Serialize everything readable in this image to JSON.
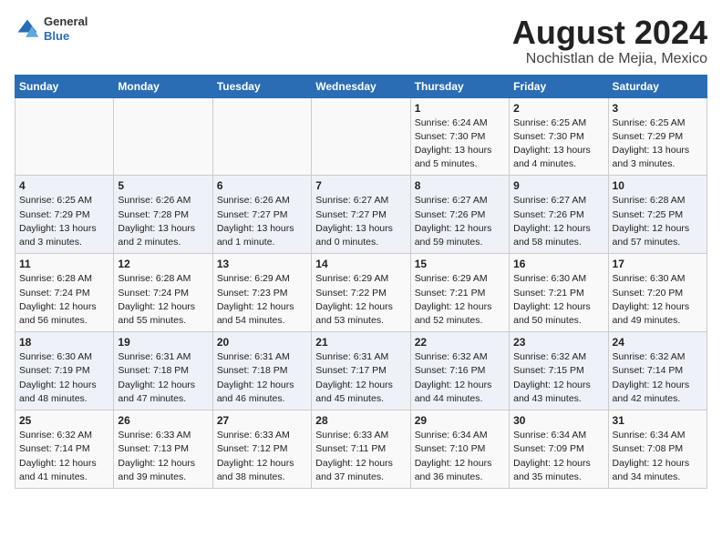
{
  "header": {
    "logo_general": "General",
    "logo_blue": "Blue",
    "title": "August 2024",
    "subtitle": "Nochistlan de Mejia, Mexico"
  },
  "days_of_week": [
    "Sunday",
    "Monday",
    "Tuesday",
    "Wednesday",
    "Thursday",
    "Friday",
    "Saturday"
  ],
  "weeks": [
    [
      {
        "day": "",
        "text": ""
      },
      {
        "day": "",
        "text": ""
      },
      {
        "day": "",
        "text": ""
      },
      {
        "day": "",
        "text": ""
      },
      {
        "day": "1",
        "text": "Sunrise: 6:24 AM\nSunset: 7:30 PM\nDaylight: 13 hours\nand 5 minutes."
      },
      {
        "day": "2",
        "text": "Sunrise: 6:25 AM\nSunset: 7:30 PM\nDaylight: 13 hours\nand 4 minutes."
      },
      {
        "day": "3",
        "text": "Sunrise: 6:25 AM\nSunset: 7:29 PM\nDaylight: 13 hours\nand 3 minutes."
      }
    ],
    [
      {
        "day": "4",
        "text": "Sunrise: 6:25 AM\nSunset: 7:29 PM\nDaylight: 13 hours\nand 3 minutes."
      },
      {
        "day": "5",
        "text": "Sunrise: 6:26 AM\nSunset: 7:28 PM\nDaylight: 13 hours\nand 2 minutes."
      },
      {
        "day": "6",
        "text": "Sunrise: 6:26 AM\nSunset: 7:27 PM\nDaylight: 13 hours\nand 1 minute."
      },
      {
        "day": "7",
        "text": "Sunrise: 6:27 AM\nSunset: 7:27 PM\nDaylight: 13 hours\nand 0 minutes."
      },
      {
        "day": "8",
        "text": "Sunrise: 6:27 AM\nSunset: 7:26 PM\nDaylight: 12 hours\nand 59 minutes."
      },
      {
        "day": "9",
        "text": "Sunrise: 6:27 AM\nSunset: 7:26 PM\nDaylight: 12 hours\nand 58 minutes."
      },
      {
        "day": "10",
        "text": "Sunrise: 6:28 AM\nSunset: 7:25 PM\nDaylight: 12 hours\nand 57 minutes."
      }
    ],
    [
      {
        "day": "11",
        "text": "Sunrise: 6:28 AM\nSunset: 7:24 PM\nDaylight: 12 hours\nand 56 minutes."
      },
      {
        "day": "12",
        "text": "Sunrise: 6:28 AM\nSunset: 7:24 PM\nDaylight: 12 hours\nand 55 minutes."
      },
      {
        "day": "13",
        "text": "Sunrise: 6:29 AM\nSunset: 7:23 PM\nDaylight: 12 hours\nand 54 minutes."
      },
      {
        "day": "14",
        "text": "Sunrise: 6:29 AM\nSunset: 7:22 PM\nDaylight: 12 hours\nand 53 minutes."
      },
      {
        "day": "15",
        "text": "Sunrise: 6:29 AM\nSunset: 7:21 PM\nDaylight: 12 hours\nand 52 minutes."
      },
      {
        "day": "16",
        "text": "Sunrise: 6:30 AM\nSunset: 7:21 PM\nDaylight: 12 hours\nand 50 minutes."
      },
      {
        "day": "17",
        "text": "Sunrise: 6:30 AM\nSunset: 7:20 PM\nDaylight: 12 hours\nand 49 minutes."
      }
    ],
    [
      {
        "day": "18",
        "text": "Sunrise: 6:30 AM\nSunset: 7:19 PM\nDaylight: 12 hours\nand 48 minutes."
      },
      {
        "day": "19",
        "text": "Sunrise: 6:31 AM\nSunset: 7:18 PM\nDaylight: 12 hours\nand 47 minutes."
      },
      {
        "day": "20",
        "text": "Sunrise: 6:31 AM\nSunset: 7:18 PM\nDaylight: 12 hours\nand 46 minutes."
      },
      {
        "day": "21",
        "text": "Sunrise: 6:31 AM\nSunset: 7:17 PM\nDaylight: 12 hours\nand 45 minutes."
      },
      {
        "day": "22",
        "text": "Sunrise: 6:32 AM\nSunset: 7:16 PM\nDaylight: 12 hours\nand 44 minutes."
      },
      {
        "day": "23",
        "text": "Sunrise: 6:32 AM\nSunset: 7:15 PM\nDaylight: 12 hours\nand 43 minutes."
      },
      {
        "day": "24",
        "text": "Sunrise: 6:32 AM\nSunset: 7:14 PM\nDaylight: 12 hours\nand 42 minutes."
      }
    ],
    [
      {
        "day": "25",
        "text": "Sunrise: 6:32 AM\nSunset: 7:14 PM\nDaylight: 12 hours\nand 41 minutes."
      },
      {
        "day": "26",
        "text": "Sunrise: 6:33 AM\nSunset: 7:13 PM\nDaylight: 12 hours\nand 39 minutes."
      },
      {
        "day": "27",
        "text": "Sunrise: 6:33 AM\nSunset: 7:12 PM\nDaylight: 12 hours\nand 38 minutes."
      },
      {
        "day": "28",
        "text": "Sunrise: 6:33 AM\nSunset: 7:11 PM\nDaylight: 12 hours\nand 37 minutes."
      },
      {
        "day": "29",
        "text": "Sunrise: 6:34 AM\nSunset: 7:10 PM\nDaylight: 12 hours\nand 36 minutes."
      },
      {
        "day": "30",
        "text": "Sunrise: 6:34 AM\nSunset: 7:09 PM\nDaylight: 12 hours\nand 35 minutes."
      },
      {
        "day": "31",
        "text": "Sunrise: 6:34 AM\nSunset: 7:08 PM\nDaylight: 12 hours\nand 34 minutes."
      }
    ]
  ]
}
